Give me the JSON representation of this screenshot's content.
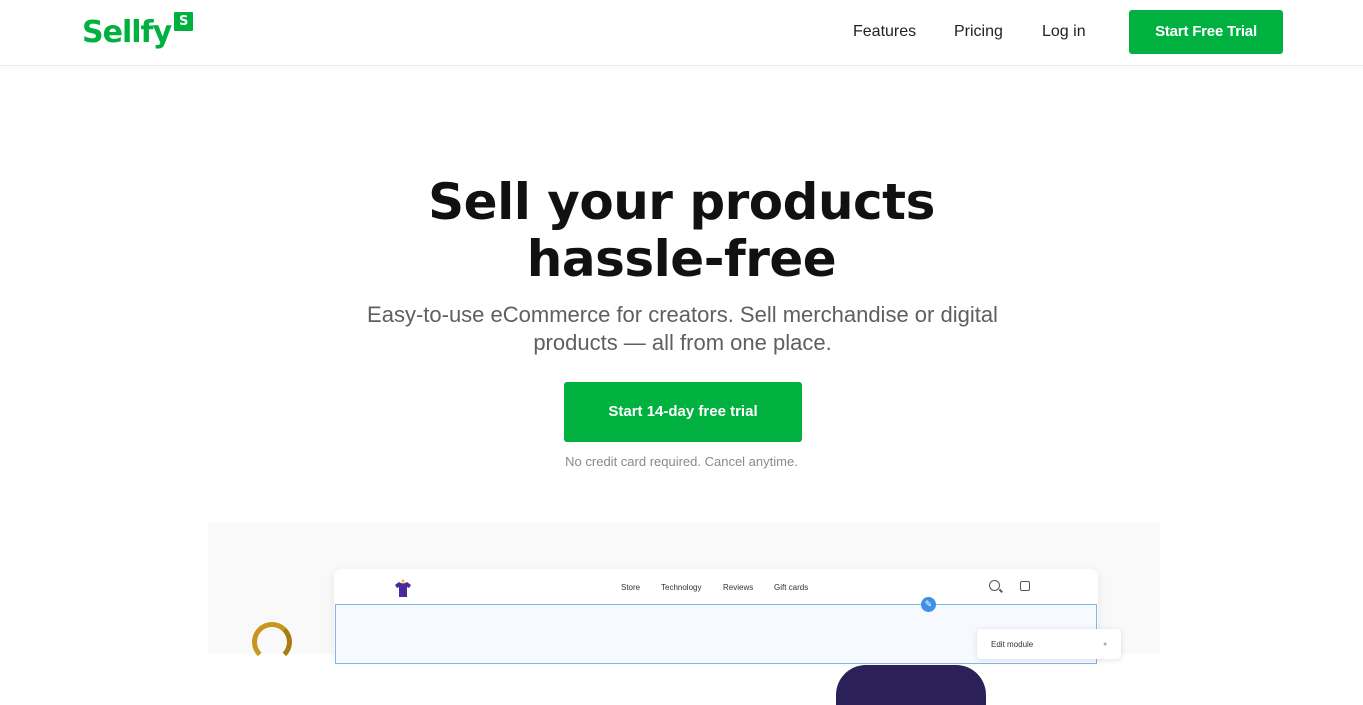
{
  "brand": {
    "name": "Sellfy",
    "badge": "S",
    "color": "#00b140"
  },
  "nav": {
    "links": [
      "Features",
      "Pricing",
      "Log in"
    ],
    "cta": "Start Free Trial"
  },
  "hero": {
    "title_line1": "Sell your products",
    "title_line2": "hassle-free",
    "subtitle": "Easy-to-use eCommerce for creators. Sell merchandise or digital products — all from one place.",
    "cta": "Start 14-day free trial",
    "note": "No credit card required. Cancel anytime."
  },
  "preview": {
    "store_nav": [
      "Store",
      "Technology",
      "Reviews",
      "Gift cards"
    ],
    "edit_panel_label": "Edit module",
    "icons": [
      "tshirt-icon",
      "search-icon",
      "cart-icon",
      "pencil-icon",
      "close-icon"
    ]
  }
}
